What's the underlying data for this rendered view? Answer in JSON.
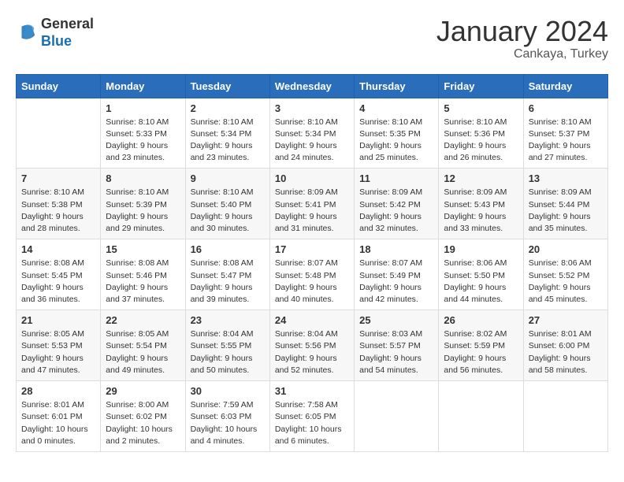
{
  "logo": {
    "general": "General",
    "blue": "Blue"
  },
  "header": {
    "month": "January 2024",
    "location": "Cankaya, Turkey"
  },
  "weekdays": [
    "Sunday",
    "Monday",
    "Tuesday",
    "Wednesday",
    "Thursday",
    "Friday",
    "Saturday"
  ],
  "weeks": [
    [
      {
        "day": "",
        "info": ""
      },
      {
        "day": "1",
        "info": "Sunrise: 8:10 AM\nSunset: 5:33 PM\nDaylight: 9 hours\nand 23 minutes."
      },
      {
        "day": "2",
        "info": "Sunrise: 8:10 AM\nSunset: 5:34 PM\nDaylight: 9 hours\nand 23 minutes."
      },
      {
        "day": "3",
        "info": "Sunrise: 8:10 AM\nSunset: 5:34 PM\nDaylight: 9 hours\nand 24 minutes."
      },
      {
        "day": "4",
        "info": "Sunrise: 8:10 AM\nSunset: 5:35 PM\nDaylight: 9 hours\nand 25 minutes."
      },
      {
        "day": "5",
        "info": "Sunrise: 8:10 AM\nSunset: 5:36 PM\nDaylight: 9 hours\nand 26 minutes."
      },
      {
        "day": "6",
        "info": "Sunrise: 8:10 AM\nSunset: 5:37 PM\nDaylight: 9 hours\nand 27 minutes."
      }
    ],
    [
      {
        "day": "7",
        "info": "Sunrise: 8:10 AM\nSunset: 5:38 PM\nDaylight: 9 hours\nand 28 minutes."
      },
      {
        "day": "8",
        "info": "Sunrise: 8:10 AM\nSunset: 5:39 PM\nDaylight: 9 hours\nand 29 minutes."
      },
      {
        "day": "9",
        "info": "Sunrise: 8:10 AM\nSunset: 5:40 PM\nDaylight: 9 hours\nand 30 minutes."
      },
      {
        "day": "10",
        "info": "Sunrise: 8:09 AM\nSunset: 5:41 PM\nDaylight: 9 hours\nand 31 minutes."
      },
      {
        "day": "11",
        "info": "Sunrise: 8:09 AM\nSunset: 5:42 PM\nDaylight: 9 hours\nand 32 minutes."
      },
      {
        "day": "12",
        "info": "Sunrise: 8:09 AM\nSunset: 5:43 PM\nDaylight: 9 hours\nand 33 minutes."
      },
      {
        "day": "13",
        "info": "Sunrise: 8:09 AM\nSunset: 5:44 PM\nDaylight: 9 hours\nand 35 minutes."
      }
    ],
    [
      {
        "day": "14",
        "info": "Sunrise: 8:08 AM\nSunset: 5:45 PM\nDaylight: 9 hours\nand 36 minutes."
      },
      {
        "day": "15",
        "info": "Sunrise: 8:08 AM\nSunset: 5:46 PM\nDaylight: 9 hours\nand 37 minutes."
      },
      {
        "day": "16",
        "info": "Sunrise: 8:08 AM\nSunset: 5:47 PM\nDaylight: 9 hours\nand 39 minutes."
      },
      {
        "day": "17",
        "info": "Sunrise: 8:07 AM\nSunset: 5:48 PM\nDaylight: 9 hours\nand 40 minutes."
      },
      {
        "day": "18",
        "info": "Sunrise: 8:07 AM\nSunset: 5:49 PM\nDaylight: 9 hours\nand 42 minutes."
      },
      {
        "day": "19",
        "info": "Sunrise: 8:06 AM\nSunset: 5:50 PM\nDaylight: 9 hours\nand 44 minutes."
      },
      {
        "day": "20",
        "info": "Sunrise: 8:06 AM\nSunset: 5:52 PM\nDaylight: 9 hours\nand 45 minutes."
      }
    ],
    [
      {
        "day": "21",
        "info": "Sunrise: 8:05 AM\nSunset: 5:53 PM\nDaylight: 9 hours\nand 47 minutes."
      },
      {
        "day": "22",
        "info": "Sunrise: 8:05 AM\nSunset: 5:54 PM\nDaylight: 9 hours\nand 49 minutes."
      },
      {
        "day": "23",
        "info": "Sunrise: 8:04 AM\nSunset: 5:55 PM\nDaylight: 9 hours\nand 50 minutes."
      },
      {
        "day": "24",
        "info": "Sunrise: 8:04 AM\nSunset: 5:56 PM\nDaylight: 9 hours\nand 52 minutes."
      },
      {
        "day": "25",
        "info": "Sunrise: 8:03 AM\nSunset: 5:57 PM\nDaylight: 9 hours\nand 54 minutes."
      },
      {
        "day": "26",
        "info": "Sunrise: 8:02 AM\nSunset: 5:59 PM\nDaylight: 9 hours\nand 56 minutes."
      },
      {
        "day": "27",
        "info": "Sunrise: 8:01 AM\nSunset: 6:00 PM\nDaylight: 9 hours\nand 58 minutes."
      }
    ],
    [
      {
        "day": "28",
        "info": "Sunrise: 8:01 AM\nSunset: 6:01 PM\nDaylight: 10 hours\nand 0 minutes."
      },
      {
        "day": "29",
        "info": "Sunrise: 8:00 AM\nSunset: 6:02 PM\nDaylight: 10 hours\nand 2 minutes."
      },
      {
        "day": "30",
        "info": "Sunrise: 7:59 AM\nSunset: 6:03 PM\nDaylight: 10 hours\nand 4 minutes."
      },
      {
        "day": "31",
        "info": "Sunrise: 7:58 AM\nSunset: 6:05 PM\nDaylight: 10 hours\nand 6 minutes."
      },
      {
        "day": "",
        "info": ""
      },
      {
        "day": "",
        "info": ""
      },
      {
        "day": "",
        "info": ""
      }
    ]
  ]
}
